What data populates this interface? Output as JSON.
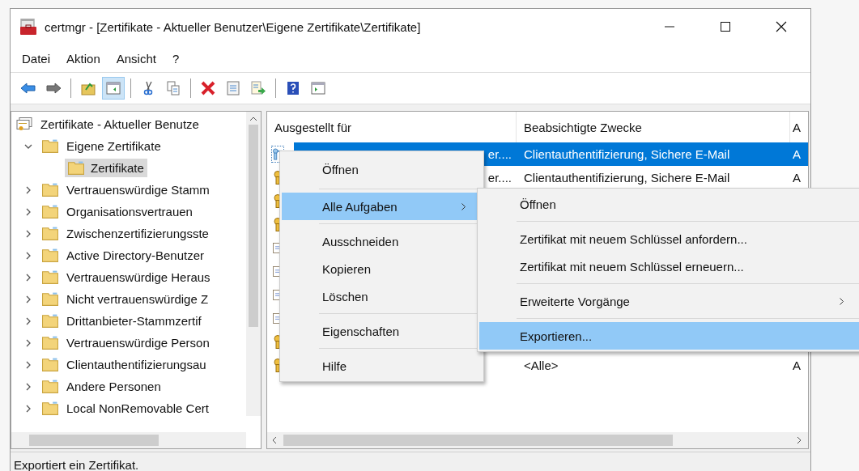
{
  "window": {
    "title": "certmgr - [Zertifikate - Aktueller Benutzer\\Eigene Zertifikate\\Zertifikate]"
  },
  "menu_bar": [
    "Datei",
    "Aktion",
    "Ansicht",
    "?"
  ],
  "toolbar": [
    {
      "kind": "back",
      "pressed": false
    },
    {
      "kind": "forward",
      "pressed": false
    },
    {
      "kind": "sep"
    },
    {
      "kind": "up",
      "pressed": false
    },
    {
      "kind": "pane",
      "pressed": true
    },
    {
      "kind": "sep"
    },
    {
      "kind": "cut",
      "pressed": false
    },
    {
      "kind": "copy",
      "pressed": false
    },
    {
      "kind": "sep"
    },
    {
      "kind": "delete",
      "pressed": false
    },
    {
      "kind": "properties",
      "pressed": false
    },
    {
      "kind": "export",
      "pressed": false
    },
    {
      "kind": "sep"
    },
    {
      "kind": "help",
      "pressed": false
    },
    {
      "kind": "action",
      "pressed": false
    }
  ],
  "tree": {
    "root": "Zertifikate - Aktueller Benutze",
    "children": [
      {
        "label": "Eigene Zertifikate",
        "expanded": true,
        "selected": false,
        "children": [
          {
            "label": "Zertifikate",
            "selected": true
          }
        ]
      },
      {
        "label": "Vertrauenswürdige Stamm",
        "expanded": false,
        "selected": false
      },
      {
        "label": "Organisationsvertrauen",
        "expanded": false,
        "selected": false
      },
      {
        "label": "Zwischenzertifizierungsste",
        "expanded": false,
        "selected": false
      },
      {
        "label": "Active Directory-Benutzer",
        "expanded": false,
        "selected": false
      },
      {
        "label": "Vertrauenswürdige Heraus",
        "expanded": false,
        "selected": false
      },
      {
        "label": "Nicht vertrauenswürdige Z",
        "expanded": false,
        "selected": false
      },
      {
        "label": "Drittanbieter-Stammzertif",
        "expanded": false,
        "selected": false
      },
      {
        "label": "Vertrauenswürdige Person",
        "expanded": false,
        "selected": false
      },
      {
        "label": "Clientauthentifizierungsau",
        "expanded": false,
        "selected": false
      },
      {
        "label": "Andere Personen",
        "expanded": false,
        "selected": false
      },
      {
        "label": "Local NonRemovable Cert",
        "expanded": false,
        "selected": false
      }
    ]
  },
  "table": {
    "columns": [
      "Ausgestellt für",
      "Beabsichtigte Zwecke",
      "A"
    ],
    "rows": [
      {
        "kind": "cert",
        "selected": true,
        "issued_to": "er....",
        "purposes": "Clientauthentifizierung, Sichere E-Mail",
        "column_3": "A"
      },
      {
        "kind": "key",
        "selected": false,
        "issued_to": "er....",
        "purposes": "Clientauthentifizierung, Sichere E-Mail",
        "column_3": "A"
      },
      {
        "kind": "key",
        "selected": false
      },
      {
        "kind": "key",
        "selected": false
      },
      {
        "kind": "doc",
        "selected": false
      },
      {
        "kind": "doc",
        "selected": false
      },
      {
        "kind": "doc",
        "selected": false
      },
      {
        "kind": "doc",
        "selected": false
      },
      {
        "kind": "key",
        "selected": false
      },
      {
        "kind": "key",
        "selected": false,
        "purposes": "<Alle>",
        "column_3": "A"
      }
    ]
  },
  "context_menu": [
    {
      "kind": "item",
      "label": "Öffnen",
      "selected": false
    },
    {
      "kind": "sep"
    },
    {
      "kind": "item",
      "label": "Alle Aufgaben",
      "selected": true,
      "submenu": true
    },
    {
      "kind": "sep"
    },
    {
      "kind": "item",
      "label": "Ausschneiden",
      "selected": false
    },
    {
      "kind": "item",
      "label": "Kopieren",
      "selected": false
    },
    {
      "kind": "item",
      "label": "Löschen",
      "selected": false
    },
    {
      "kind": "sep"
    },
    {
      "kind": "item",
      "label": "Eigenschaften",
      "selected": false
    },
    {
      "kind": "sep"
    },
    {
      "kind": "item",
      "label": "Hilfe",
      "selected": false
    }
  ],
  "submenu": [
    {
      "kind": "item",
      "label": "Öffnen",
      "selected": false
    },
    {
      "kind": "sep"
    },
    {
      "kind": "item",
      "label": "Zertifikat mit neuem Schlüssel anfordern...",
      "selected": false
    },
    {
      "kind": "item",
      "label": "Zertifikat mit neuem Schlüssel erneuern...",
      "selected": false
    },
    {
      "kind": "sep"
    },
    {
      "kind": "item",
      "label": "Erweiterte Vorgänge",
      "selected": false,
      "submenu": true
    },
    {
      "kind": "sep"
    },
    {
      "kind": "item",
      "label": "Exportieren...",
      "selected": true
    }
  ],
  "status_bar": "Exportiert ein Zertifikat."
}
